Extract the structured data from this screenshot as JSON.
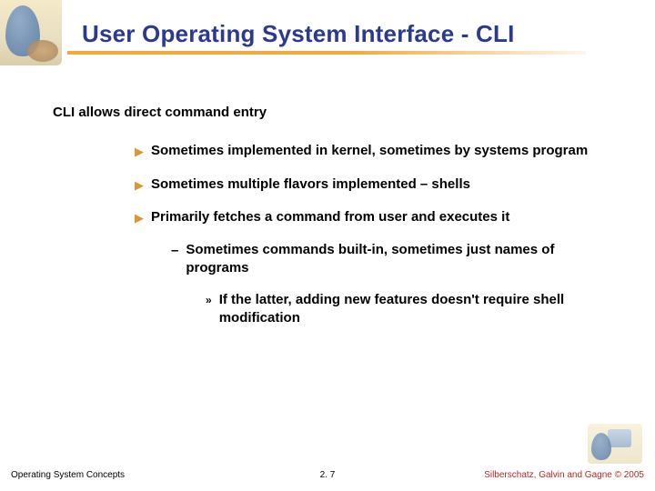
{
  "title": "User Operating System Interface - CLI",
  "lead": "CLI allows direct command entry",
  "bullets": [
    "Sometimes implemented in kernel, sometimes by systems program",
    "Sometimes multiple flavors implemented – shells",
    "Primarily fetches a command from user and executes it"
  ],
  "sub": "Sometimes commands built-in, sometimes just names of programs",
  "sub2": "If the latter, adding new features doesn't require shell modification",
  "footer": {
    "left": "Operating System Concepts",
    "center": "2. 7",
    "right": "Silberschatz, Galvin and Gagne © 2005"
  }
}
